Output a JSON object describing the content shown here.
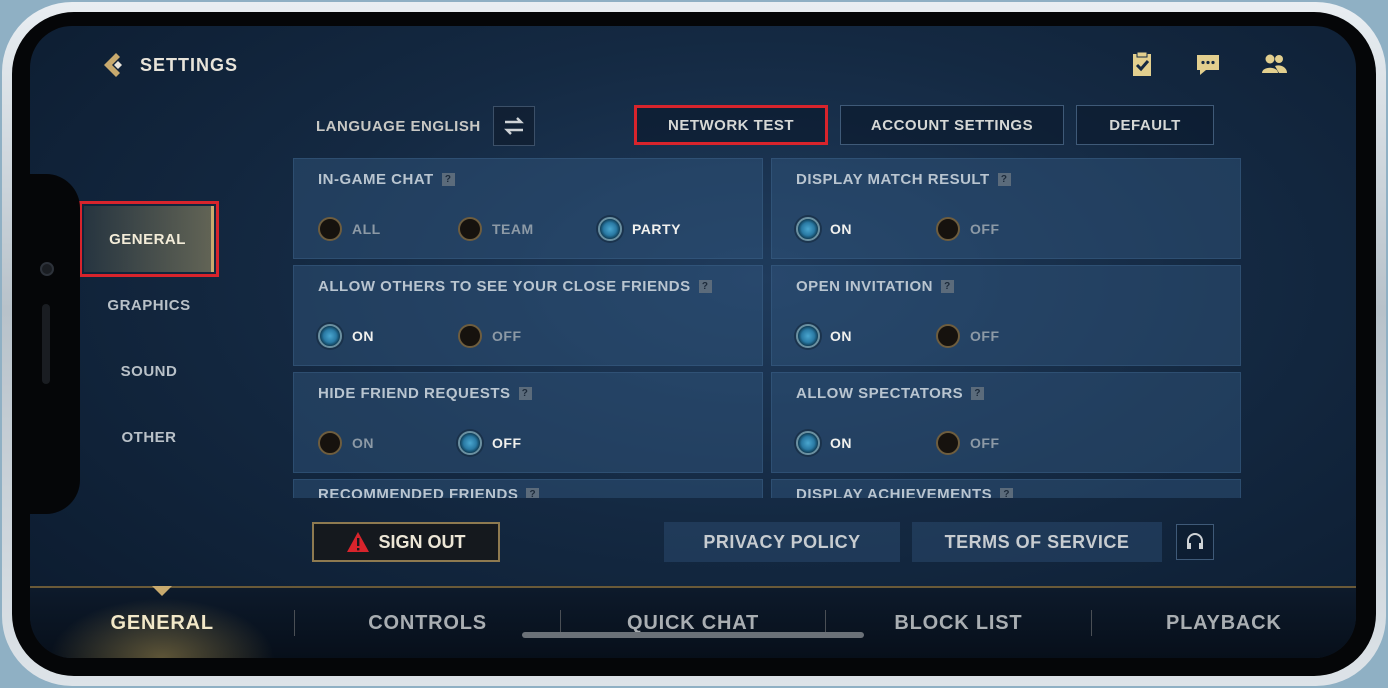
{
  "header": {
    "title": "SETTINGS"
  },
  "top_icons": [
    "clipboard-icon",
    "chat-icon",
    "friends-icon"
  ],
  "left_nav": [
    {
      "label": "GENERAL",
      "active": true
    },
    {
      "label": "GRAPHICS",
      "active": false
    },
    {
      "label": "SOUND",
      "active": false
    },
    {
      "label": "OTHER",
      "active": false
    }
  ],
  "language": {
    "label": "LANGUAGE",
    "value": "ENGLISH"
  },
  "top_buttons": {
    "network_test": "NETWORK TEST",
    "account_settings": "ACCOUNT SETTINGS",
    "default": "DEFAULT"
  },
  "settings": {
    "in_game_chat": {
      "title": "IN-GAME CHAT",
      "options": [
        "ALL",
        "TEAM",
        "PARTY"
      ],
      "selected": "PARTY"
    },
    "display_match_result": {
      "title": "DISPLAY MATCH RESULT",
      "options": [
        "ON",
        "OFF"
      ],
      "selected": "ON"
    },
    "close_friends": {
      "title": "ALLOW OTHERS TO SEE YOUR CLOSE FRIENDS",
      "options": [
        "ON",
        "OFF"
      ],
      "selected": "ON"
    },
    "open_invitation": {
      "title": "OPEN INVITATION",
      "options": [
        "ON",
        "OFF"
      ],
      "selected": "ON"
    },
    "hide_friend_requests": {
      "title": "HIDE FRIEND REQUESTS",
      "options": [
        "ON",
        "OFF"
      ],
      "selected": "OFF"
    },
    "allow_spectators": {
      "title": "ALLOW SPECTATORS",
      "options": [
        "ON",
        "OFF"
      ],
      "selected": "ON"
    },
    "recommended_friends": {
      "title": "RECOMMENDED FRIENDS"
    },
    "display_achievements": {
      "title": "DISPLAY ACHIEVEMENTS"
    }
  },
  "help_mark": "?",
  "actions": {
    "sign_out": "SIGN OUT",
    "privacy_policy": "PRIVACY POLICY",
    "terms_of_service": "TERMS OF SERVICE"
  },
  "bottom_tabs": [
    {
      "label": "GENERAL",
      "active": true
    },
    {
      "label": "CONTROLS",
      "active": false
    },
    {
      "label": "QUICK CHAT",
      "active": false
    },
    {
      "label": "BLOCK LIST",
      "active": false
    },
    {
      "label": "PLAYBACK",
      "active": false
    }
  ],
  "colors": {
    "accent_gold": "#c8aa6e",
    "highlight_red": "#d8242c",
    "radio_on": "#2a7aa4"
  }
}
